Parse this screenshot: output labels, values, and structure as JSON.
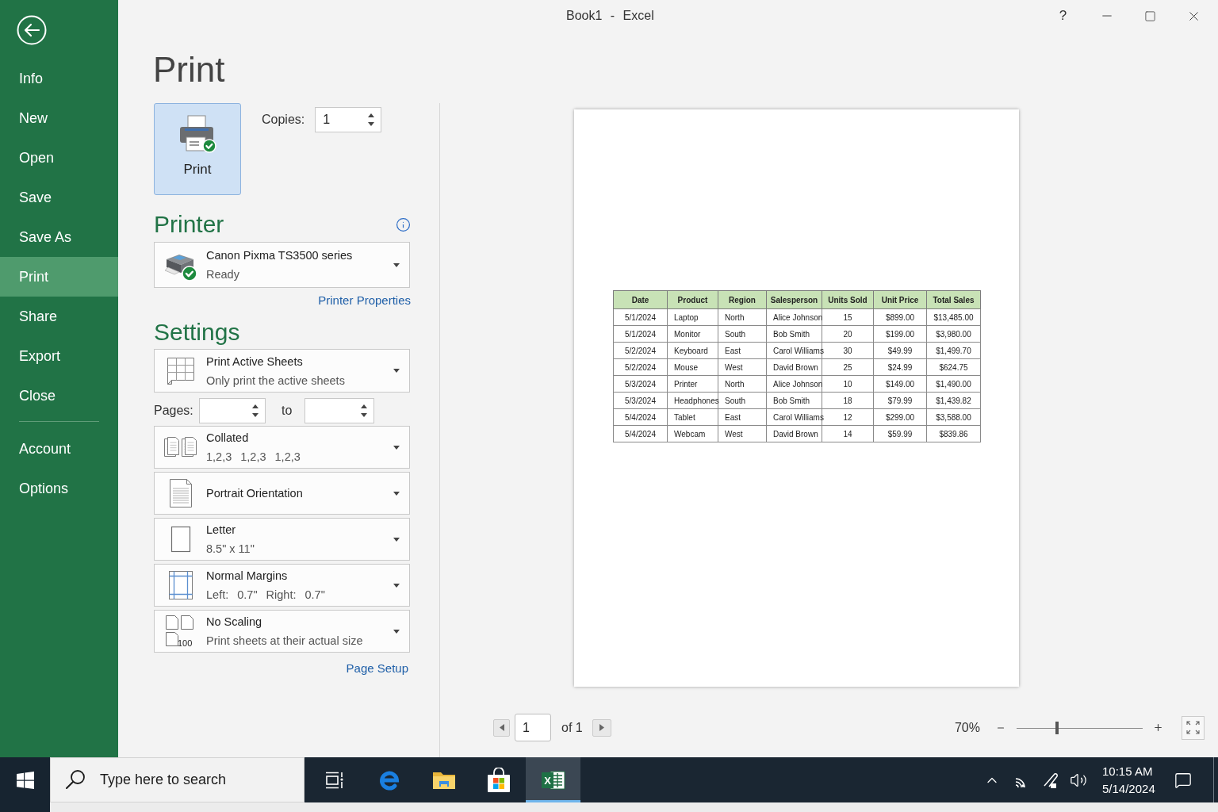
{
  "window": {
    "title": "Book1 - Excel",
    "help": "?"
  },
  "sidebar": {
    "items": [
      {
        "label": "Info",
        "selected": false
      },
      {
        "label": "New",
        "selected": false
      },
      {
        "label": "Open",
        "selected": false
      },
      {
        "label": "Save",
        "selected": false
      },
      {
        "label": "Save As",
        "selected": false
      },
      {
        "label": "Print",
        "selected": true
      },
      {
        "label": "Share",
        "selected": false
      },
      {
        "label": "Export",
        "selected": false
      },
      {
        "label": "Close",
        "selected": false
      }
    ],
    "footer_items": [
      {
        "label": "Account",
        "selected": false
      },
      {
        "label": "Options",
        "selected": false
      }
    ]
  },
  "print": {
    "heading": "Print",
    "print_button": "Print",
    "copies": {
      "label": "Copies:",
      "value": "1"
    }
  },
  "printer": {
    "heading": "Printer",
    "name": "Canon Pixma TS3500 series",
    "status": "Ready",
    "properties_link": "Printer Properties"
  },
  "settings": {
    "heading": "Settings",
    "items": [
      {
        "kind": "sheets",
        "title": "Print Active Sheets",
        "detail": "Only print the active sheets"
      },
      {
        "kind": "pages",
        "label": "Pages:",
        "to": "to"
      },
      {
        "kind": "collation",
        "title": "Collated",
        "detail": "1,2,3 1,2,3 1,2,3"
      },
      {
        "kind": "orientation",
        "title": "Portrait Orientation"
      },
      {
        "kind": "paper",
        "title": "Letter",
        "detail": "8.5\" x 11\""
      },
      {
        "kind": "margins",
        "title": "Normal Margins",
        "detail": "Left: 0.7\" Right: 0.7\""
      },
      {
        "kind": "scaling",
        "title": "No Scaling",
        "detail": "Print sheets at their actual size",
        "icon_text": "100"
      }
    ],
    "page_setup_link": "Page Setup"
  },
  "preview": {
    "table": {
      "columns": [
        "Date",
        "Product",
        "Region",
        "Salesperson",
        "Units Sold",
        "Unit Price",
        "Total Sales"
      ],
      "rows": [
        [
          "5/1/2024",
          "Laptop",
          "North",
          "Alice Johnson",
          "15",
          "$899.00",
          "$13,485.00"
        ],
        [
          "5/1/2024",
          "Monitor",
          "South",
          "Bob Smith",
          "20",
          "$199.00",
          "$3,980.00"
        ],
        [
          "5/2/2024",
          "Keyboard",
          "East",
          "Carol Williams",
          "30",
          "$49.99",
          "$1,499.70"
        ],
        [
          "5/2/2024",
          "Mouse",
          "West",
          "David Brown",
          "25",
          "$24.99",
          "$624.75"
        ],
        [
          "5/3/2024",
          "Printer",
          "North",
          "Alice Johnson",
          "10",
          "$149.00",
          "$1,490.00"
        ],
        [
          "5/3/2024",
          "Headphones",
          "South",
          "Bob Smith",
          "18",
          "$79.99",
          "$1,439.82"
        ],
        [
          "5/4/2024",
          "Tablet",
          "East",
          "Carol Williams",
          "12",
          "$299.00",
          "$3,588.00"
        ],
        [
          "5/4/2024",
          "Webcam",
          "West",
          "David Brown",
          "14",
          "$59.99",
          "$839.86"
        ]
      ]
    },
    "page_nav": {
      "page": "1",
      "total": "of 1"
    },
    "zoom": {
      "reading": "70%",
      "level": 0.32
    }
  },
  "taskbar": {
    "search_placeholder": "Type here to search",
    "apps": [
      {
        "kind": "task-view",
        "selected": false
      },
      {
        "kind": "browser",
        "selected": false
      },
      {
        "kind": "files",
        "selected": false
      },
      {
        "kind": "store",
        "selected": false
      },
      {
        "kind": "spreadsheet",
        "selected": true,
        "glyph": "X"
      }
    ],
    "clock": {
      "time": "10:15 AM",
      "date": "5/14/2024"
    }
  }
}
